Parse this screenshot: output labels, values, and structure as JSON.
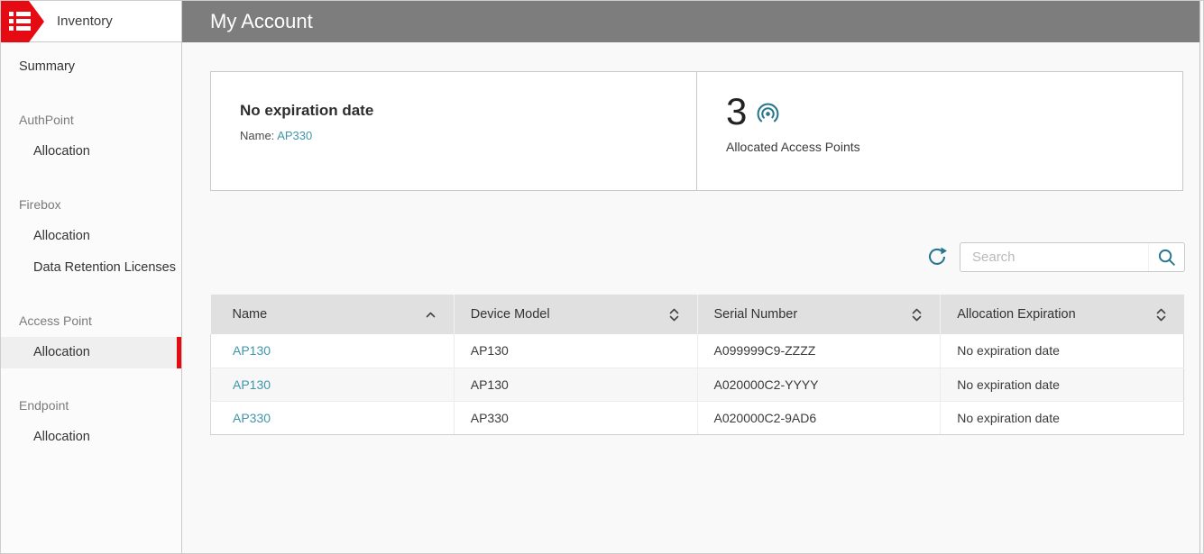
{
  "sidebar": {
    "title": "Inventory",
    "groups": [
      {
        "items": [
          {
            "label": "Summary"
          }
        ]
      },
      {
        "header": "AuthPoint",
        "items": [
          {
            "label": "Allocation"
          }
        ]
      },
      {
        "header": "Firebox",
        "items": [
          {
            "label": "Allocation"
          },
          {
            "label": "Data Retention Licenses"
          }
        ]
      },
      {
        "header": "Access Point",
        "items": [
          {
            "label": "Allocation",
            "selected": true
          }
        ]
      },
      {
        "header": "Endpoint",
        "items": [
          {
            "label": "Allocation"
          }
        ]
      }
    ]
  },
  "header": {
    "title": "My Account"
  },
  "cards": {
    "expiration_card": {
      "title": "No expiration date",
      "name_label": "Name:",
      "name_link": "AP330"
    },
    "allocated_card": {
      "count": "3",
      "icon": "access-point-icon",
      "label": "Allocated Access Points"
    }
  },
  "toolbar": {
    "refresh_icon": "refresh-icon",
    "search_placeholder": "Search",
    "search_value": "",
    "search_icon": "search-icon"
  },
  "table": {
    "columns": [
      {
        "label": "Name",
        "sort": "ascending"
      },
      {
        "label": "Device Model",
        "sort": "none"
      },
      {
        "label": "Serial Number",
        "sort": "none"
      },
      {
        "label": "Allocation Expiration",
        "sort": "none"
      }
    ],
    "rows": [
      {
        "name": "AP130",
        "device_model": "AP130",
        "serial_number": "A099999C9-ZZZZ",
        "allocation_expiration": "No expiration date"
      },
      {
        "name": "AP130",
        "device_model": "AP130",
        "serial_number": "A020000C2-YYYY",
        "allocation_expiration": "No expiration date"
      },
      {
        "name": "AP330",
        "device_model": "AP330",
        "serial_number": "A020000C2-9AD6",
        "allocation_expiration": "No expiration date"
      }
    ]
  },
  "colors": {
    "brand_red": "#e60b12",
    "link_teal": "#4096ab",
    "icon_teal": "#27778f",
    "topbar_gray": "#7d7d7d",
    "table_header_gray": "#e0e0e0"
  }
}
